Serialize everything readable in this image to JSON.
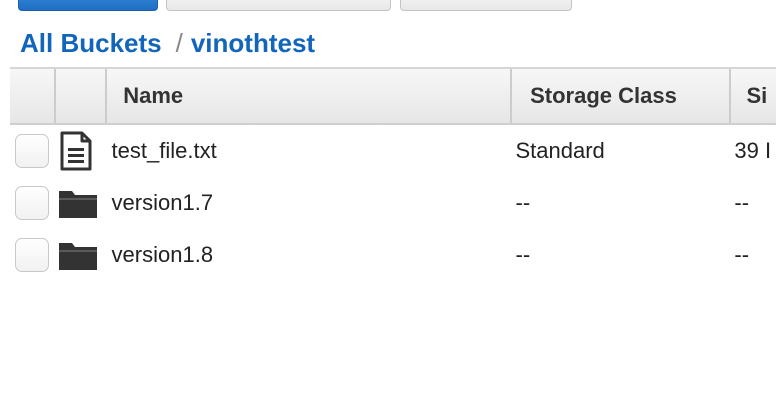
{
  "breadcrumb": {
    "root": "All Buckets",
    "separator": "/",
    "current": "vinothtest"
  },
  "table": {
    "columns": {
      "name": "Name",
      "storage_class": "Storage Class",
      "size": "Si"
    },
    "rows": [
      {
        "type": "file",
        "icon": "document-icon",
        "name": "test_file.txt",
        "storage_class": "Standard",
        "size": "39 I"
      },
      {
        "type": "folder",
        "icon": "folder-icon",
        "name": "version1.7",
        "storage_class": "--",
        "size": "--"
      },
      {
        "type": "folder",
        "icon": "folder-icon",
        "name": "version1.8",
        "storage_class": "--",
        "size": "--"
      }
    ]
  },
  "colors": {
    "link": "#1166bb",
    "primary_button": "#1f6fc4"
  }
}
